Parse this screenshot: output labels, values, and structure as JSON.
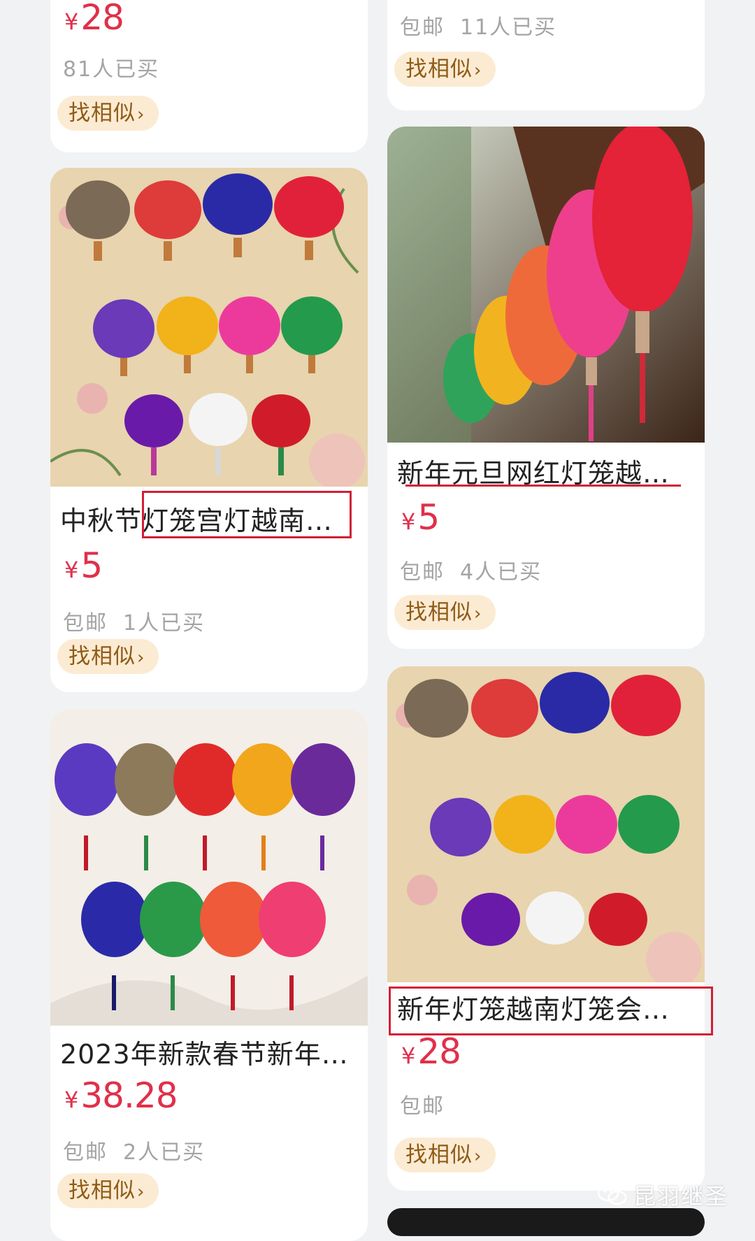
{
  "similar_label": "找相似",
  "chevron": "›",
  "currency": "¥",
  "colors": {
    "price": "#e0304a",
    "pill_bg": "#fcebd3",
    "pill_text": "#8f5b16",
    "highlight": "#d21f36"
  },
  "products": [
    {
      "price": "28",
      "meta": [
        "81人已买"
      ]
    },
    {
      "price": "",
      "meta": [
        "包邮",
        "11人已买"
      ]
    },
    {
      "title": "中秋节灯笼宫灯越南…",
      "price": "5",
      "meta": [
        "包邮",
        "1人已买"
      ]
    },
    {
      "title": "新年元旦网红灯笼越…",
      "price": "5",
      "meta": [
        "包邮",
        "4人已买"
      ]
    },
    {
      "title": "2023年新款春节新年…",
      "price": "38.28",
      "meta": [
        "包邮",
        "2人已买"
      ]
    },
    {
      "title": "新年灯笼越南灯笼会…",
      "price": "28",
      "meta": [
        "包邮"
      ]
    }
  ],
  "watermark": {
    "icon": "wechat-icon",
    "text": "昆羽继圣"
  }
}
